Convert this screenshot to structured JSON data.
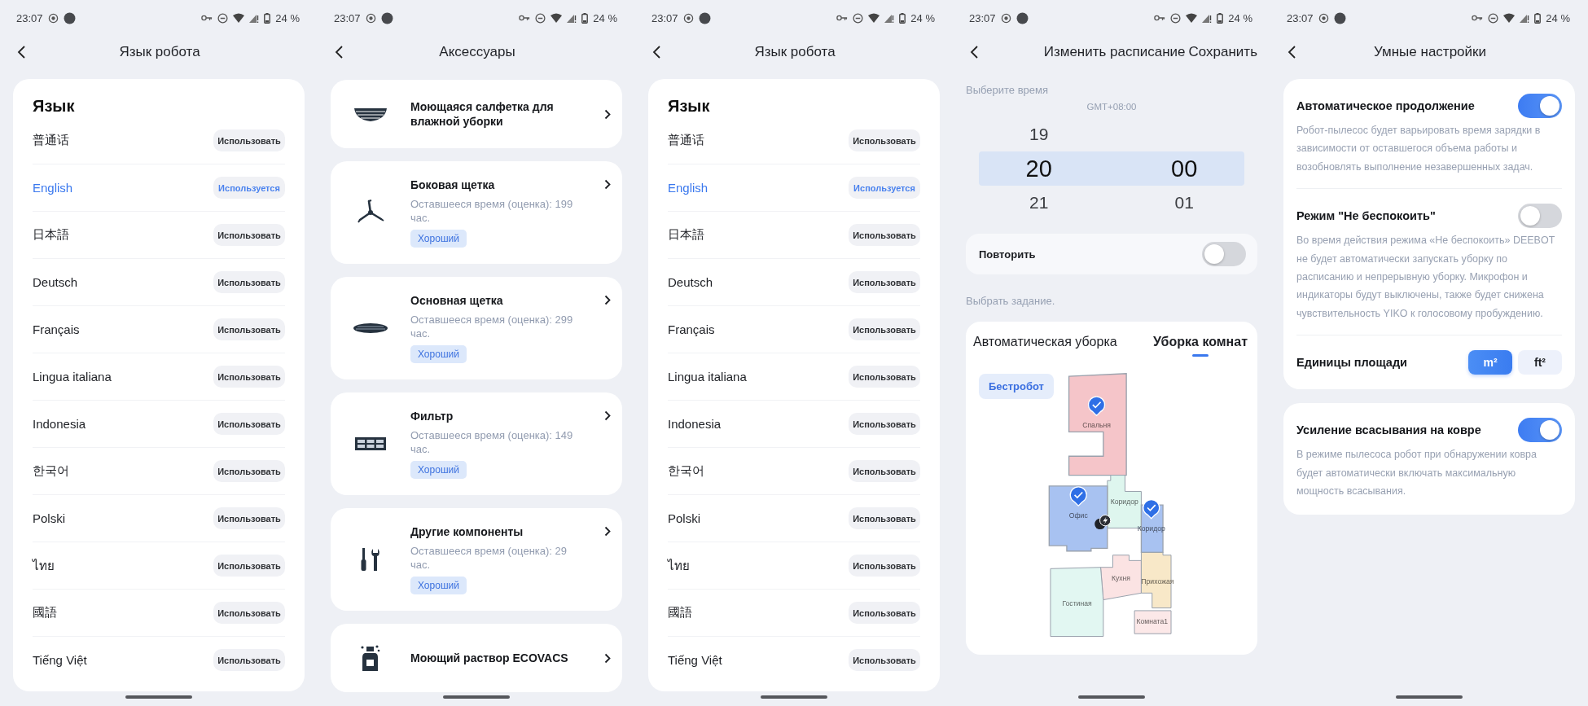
{
  "screens": [
    {
      "kind": "languages",
      "status_bar": {
        "time": "23:07",
        "battery": "24 %"
      },
      "header": {
        "title": "Язык робота"
      },
      "section_title": "Язык",
      "languages": [
        {
          "name": "普通话",
          "action": "Использовать",
          "selected": false
        },
        {
          "name": "English",
          "action": "Используется",
          "selected": true
        },
        {
          "name": "日本語",
          "action": "Использовать",
          "selected": false
        },
        {
          "name": "Deutsch",
          "action": "Использовать",
          "selected": false
        },
        {
          "name": "Français",
          "action": "Использовать",
          "selected": false
        },
        {
          "name": "Lingua italiana",
          "action": "Использовать",
          "selected": false
        },
        {
          "name": "Indonesia",
          "action": "Использовать",
          "selected": false
        },
        {
          "name": "한국어",
          "action": "Использовать",
          "selected": false
        },
        {
          "name": "Polski",
          "action": "Использовать",
          "selected": false
        },
        {
          "name": "ไทย",
          "action": "Использовать",
          "selected": false
        },
        {
          "name": "國語",
          "action": "Использовать",
          "selected": false
        },
        {
          "name": "Tiếng Việt",
          "action": "Использовать",
          "selected": false
        }
      ]
    },
    {
      "kind": "accessories",
      "status_bar": {
        "time": "23:07",
        "battery": "24 %"
      },
      "header": {
        "title": "Аксессуары"
      },
      "items": [
        {
          "kind": "mop",
          "name": "Моющаяся салфетка для влажной уборки"
        },
        {
          "kind": "side-brush",
          "name": "Боковая щетка",
          "remaining": "Оставшееся время (оценка): 199 час.",
          "condition": "Хороший"
        },
        {
          "kind": "main-brush",
          "name": "Основная щетка",
          "remaining": "Оставшееся время (оценка): 299 час.",
          "condition": "Хороший"
        },
        {
          "kind": "filter",
          "name": "Фильтр",
          "remaining": "Оставшееся время (оценка): 149 час.",
          "condition": "Хороший"
        },
        {
          "kind": "tools",
          "name": "Другие компоненты",
          "remaining": "Оставшееся время (оценка): 29 час.",
          "condition": "Хороший"
        },
        {
          "kind": "bottle",
          "name": "Моющий раствор ECOVACS"
        }
      ]
    },
    {
      "kind": "languages",
      "status_bar": {
        "time": "23:07",
        "battery": "24 %"
      },
      "header": {
        "title": "Язык робота"
      },
      "section_title": "Язык",
      "languages": [
        {
          "name": "普通话",
          "action": "Использовать",
          "selected": false
        },
        {
          "name": "English",
          "action": "Используется",
          "selected": true
        },
        {
          "name": "日本語",
          "action": "Использовать",
          "selected": false
        },
        {
          "name": "Deutsch",
          "action": "Использовать",
          "selected": false
        },
        {
          "name": "Français",
          "action": "Использовать",
          "selected": false
        },
        {
          "name": "Lingua italiana",
          "action": "Использовать",
          "selected": false
        },
        {
          "name": "Indonesia",
          "action": "Использовать",
          "selected": false
        },
        {
          "name": "한국어",
          "action": "Использовать",
          "selected": false
        },
        {
          "name": "Polski",
          "action": "Использовать",
          "selected": false
        },
        {
          "name": "ไทย",
          "action": "Использовать",
          "selected": false
        },
        {
          "name": "國語",
          "action": "Использовать",
          "selected": false
        },
        {
          "name": "Tiếng Việt",
          "action": "Использовать",
          "selected": false
        }
      ]
    },
    {
      "kind": "schedule",
      "status_bar": {
        "time": "23:07",
        "battery": "24 %"
      },
      "header": {
        "title": "Изменить расписание",
        "action": "Сохранить"
      },
      "time_label": "Выберите время",
      "timezone": "GMT+08:00",
      "picker": {
        "hours": {
          "above": "19",
          "current": "20",
          "below": "21"
        },
        "minutes": {
          "current": "00",
          "below": "01"
        }
      },
      "repeat": {
        "label": "Повторить",
        "on": false
      },
      "task_label": "Выбрать задание.",
      "tabs": [
        {
          "label": "Автоматическая уборка",
          "selected": false
        },
        {
          "label": "Уборка комнат",
          "selected": true
        }
      ],
      "map": {
        "chip": "Бестробот",
        "rooms": [
          {
            "name": "Спальня",
            "color": "#f5c5c9",
            "selected": true
          },
          {
            "name": "Коридор",
            "color": "#def6ee",
            "selected": false
          },
          {
            "name": "Офис",
            "color": "#a8c2f1",
            "selected": true
          },
          {
            "name": "Коридор",
            "color": "#a8c2f1",
            "selected": true
          },
          {
            "name": "Кухня",
            "color": "#fbe3e3",
            "selected": false
          },
          {
            "name": "Прихожая",
            "color": "#f8e8c8",
            "selected": false
          },
          {
            "name": "Гостиная",
            "color": "#e2f7f2",
            "selected": false
          },
          {
            "name": "Комната1",
            "color": "#fce8e8",
            "selected": false
          }
        ]
      }
    },
    {
      "kind": "smart",
      "status_bar": {
        "time": "23:07",
        "battery": "24 %"
      },
      "header": {
        "title": "Умные настройки"
      },
      "cards": [
        {
          "settings": [
            {
              "kind": "toggle",
              "title": "Автоматическое продолжение",
              "on": true,
              "description": "Робот-пылесос будет варьировать время зарядки в зависимости от оставшегося объема работы и возобновлять выполнение незавершенных задач."
            },
            {
              "kind": "toggle",
              "title": "Режим \"Не беспокоить\"",
              "on": false,
              "description": "Во время действия режима «Не беспокоить» DEEBOT не будет автоматически запускать уборку по расписанию и непрерывную уборку. Микрофон и индикаторы будут выключены, также будет снижена чувствительность YIKO к голосовому пробуждению."
            },
            {
              "kind": "units",
              "title": "Единицы площади",
              "options": [
                {
                  "label": "m²",
                  "selected": true
                },
                {
                  "label": "ft²",
                  "selected": false
                }
              ]
            }
          ]
        },
        {
          "settings": [
            {
              "kind": "toggle",
              "title": "Усиление всасывания на ковре",
              "on": true,
              "description": "В режиме пылесоса робот при обнаружении ковра будет автоматически включать максимальную мощность всасывания."
            }
          ]
        }
      ]
    }
  ]
}
